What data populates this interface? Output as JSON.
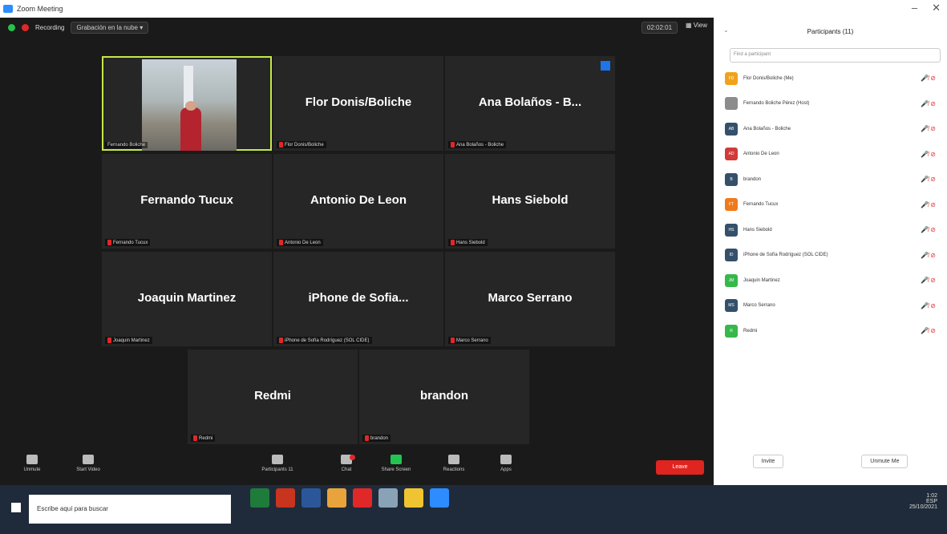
{
  "window": {
    "title": "Zoom Meeting",
    "min": "–",
    "close": "✕"
  },
  "topbar": {
    "recording": "Recording",
    "view_pill": "Grabación en la nube ▾",
    "time": "02:02:01",
    "view_label": "View"
  },
  "tiles": [
    {
      "name": "Fernando Boliche Pérez",
      "caption": "Fernando Boliche",
      "video": true
    },
    {
      "name": "Flor Donis/Boliche",
      "caption": "Flor Donis/Boliche"
    },
    {
      "name": "Ana Bolaños - B...",
      "caption": "Ana Bolaños - Boliche"
    },
    {
      "name": "Fernando Tucux",
      "caption": "Fernando Tucux"
    },
    {
      "name": "Antonio De Leon",
      "caption": "Antonio De Leon"
    },
    {
      "name": "Hans Siebold",
      "caption": "Hans Siebold"
    },
    {
      "name": "Joaquin Martinez",
      "caption": "Joaquin Martinez"
    },
    {
      "name": "iPhone de Sofia...",
      "caption": "iPhone de Sofía Rodríguez (SOL CIDE)"
    },
    {
      "name": "Marco Serrano",
      "caption": "Marco Serrano"
    },
    {
      "name": "Redmi",
      "caption": "Redmi"
    },
    {
      "name": "brandon",
      "caption": "brandon"
    }
  ],
  "toolbar": {
    "unmute": "Unmute",
    "start_video": "Start Video",
    "participants": "Participants",
    "participants_count": "11",
    "chat": "Chat",
    "share_screen": "Share Screen",
    "reactions": "Reactions",
    "apps": "Apps",
    "leave": "Leave"
  },
  "panel": {
    "title": "Participants (11)",
    "search_placeholder": "Find a participant",
    "participants": [
      {
        "initials": "FD",
        "name": "Flor Donis/Boliche (Me)",
        "color": "#f2a219"
      },
      {
        "initials": "",
        "name": "Fernando Boliche Pérez (Host)",
        "color": "#8c8c8c"
      },
      {
        "initials": "AB",
        "name": "Ana Bolaños - Boliche",
        "color": "#34506b"
      },
      {
        "initials": "AD",
        "name": "Antonio De Leon",
        "color": "#d03a3a"
      },
      {
        "initials": "B",
        "name": "brandon",
        "color": "#34506b"
      },
      {
        "initials": "FT",
        "name": "Fernando Tucux",
        "color": "#f07a1a"
      },
      {
        "initials": "HS",
        "name": "Hans Siebold",
        "color": "#34506b"
      },
      {
        "initials": "ID",
        "name": "iPhone de Sofía Rodríguez (SOL CIDE)",
        "color": "#34506b"
      },
      {
        "initials": "JM",
        "name": "Joaquin Martinez",
        "color": "#36b84a"
      },
      {
        "initials": "MS",
        "name": "Marco Serrano",
        "color": "#34506b"
      },
      {
        "initials": "R",
        "name": "Redmi",
        "color": "#36b84a"
      }
    ],
    "invite": "Invite",
    "unmute_me": "Unmute Me"
  },
  "taskbar": {
    "search": "Escribe aquí para buscar",
    "time": "1:02",
    "lang": "ESP",
    "date": "25/10/2021"
  }
}
